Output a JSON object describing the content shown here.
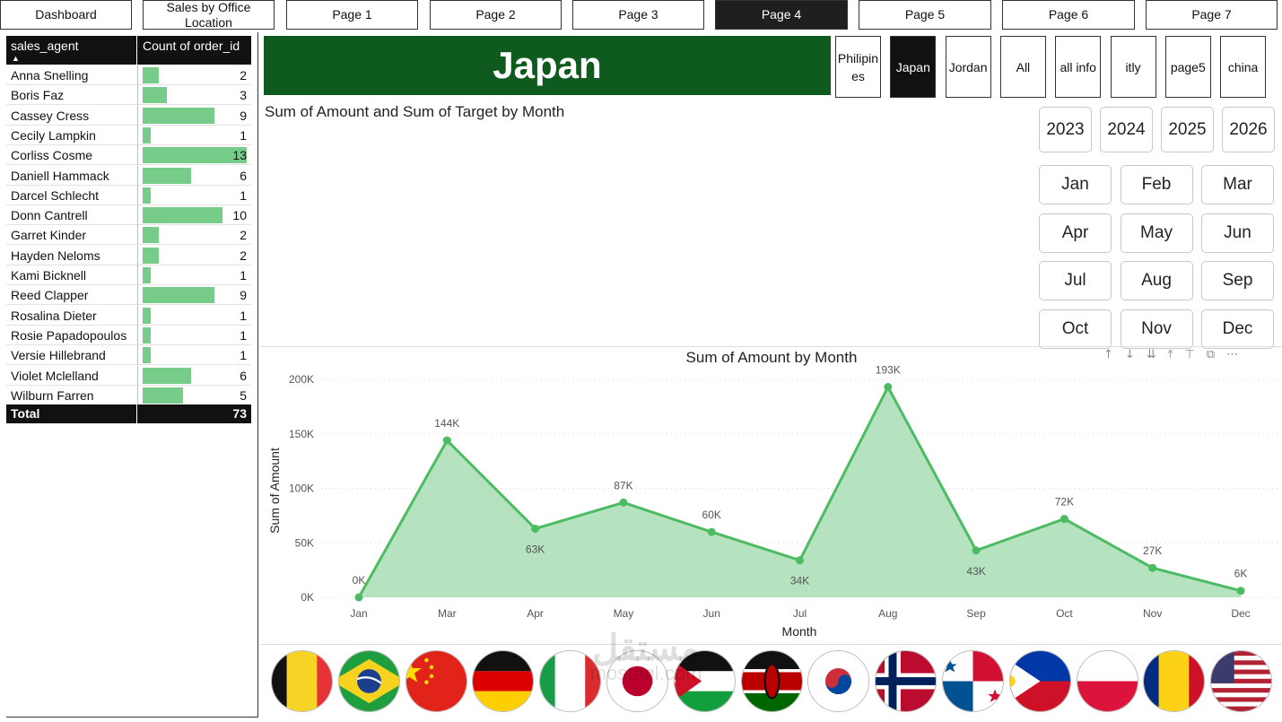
{
  "nav": {
    "tabs": [
      "Dashboard",
      "Sales by Office Location",
      "Page 1",
      "Page 2",
      "Page 3",
      "Page 4",
      "Page 5",
      "Page 6",
      "Page 7"
    ],
    "active": "Page 4"
  },
  "table": {
    "col1": "sales_agent",
    "col2": "Count of order_id",
    "sort_glyph": "▲",
    "rows": [
      {
        "name": "Anna Snelling",
        "count": 2
      },
      {
        "name": "Boris Faz",
        "count": 3
      },
      {
        "name": "Cassey Cress",
        "count": 9
      },
      {
        "name": "Cecily Lampkin",
        "count": 1
      },
      {
        "name": "Corliss Cosme",
        "count": 13
      },
      {
        "name": "Daniell Hammack",
        "count": 6
      },
      {
        "name": "Darcel Schlecht",
        "count": 1
      },
      {
        "name": "Donn Cantrell",
        "count": 10
      },
      {
        "name": "Garret Kinder",
        "count": 2
      },
      {
        "name": "Hayden Neloms",
        "count": 2
      },
      {
        "name": "Kami Bicknell",
        "count": 1
      },
      {
        "name": "Reed Clapper",
        "count": 9
      },
      {
        "name": "Rosalina Dieter",
        "count": 1
      },
      {
        "name": "Rosie Papadopoulos",
        "count": 1
      },
      {
        "name": "Versie Hillebrand",
        "count": 1
      },
      {
        "name": "Violet Mclelland",
        "count": 6
      },
      {
        "name": "Wilburn Farren",
        "count": 5
      }
    ],
    "total_label": "Total",
    "total_value": "73",
    "bar_color": "#77cc8a"
  },
  "banner": {
    "title": "Japan",
    "color": "#0e5a1f"
  },
  "country_slicers": {
    "items": [
      "Philipines",
      "Japan",
      "Jordan",
      "All",
      "all info",
      "itly",
      "page5",
      "china"
    ],
    "active": "Japan"
  },
  "top_chart_title": "Sum of Amount and Sum of Target by Month",
  "years": [
    "2023",
    "2024",
    "2025",
    "2026"
  ],
  "months": [
    "Jan",
    "Feb",
    "Mar",
    "Apr",
    "May",
    "Jun",
    "Jul",
    "Aug",
    "Sep",
    "Oct",
    "Nov",
    "Dec"
  ],
  "chart_data": {
    "type": "area",
    "title": "Sum of Amount by Month",
    "xlabel": "Month",
    "ylabel": "Sum of Amount",
    "categories": [
      "Jan",
      "Mar",
      "Apr",
      "May",
      "Jun",
      "Jul",
      "Aug",
      "Sep",
      "Oct",
      "Nov",
      "Dec"
    ],
    "values": [
      0,
      144000,
      63000,
      87000,
      60000,
      34000,
      193000,
      43000,
      72000,
      27000,
      6000
    ],
    "data_labels": [
      "0K",
      "144K",
      "63K",
      "87K",
      "60K",
      "34K",
      "193K",
      "43K",
      "72K",
      "27K",
      "6K"
    ],
    "yticks": [
      "0K",
      "50K",
      "100K",
      "150K",
      "200K"
    ],
    "ylim": [
      0,
      200000
    ],
    "line_color": "#4cbb62",
    "fill_color": "#b5e3bf",
    "grid": true
  },
  "toolbar_icons": [
    "arrow-up-icon",
    "arrow-down-icon",
    "double-arrow-down-icon",
    "expand-icon",
    "pin-icon",
    "focus-icon",
    "more-icon"
  ],
  "flags": [
    "belgium",
    "brazil",
    "china",
    "germany",
    "italy",
    "japan",
    "jordan",
    "kenya",
    "south-korea",
    "norway",
    "panama",
    "philippines",
    "poland",
    "romania",
    "usa"
  ],
  "watermark": {
    "line1": "مستقل",
    "line2": "mostaql.com"
  }
}
